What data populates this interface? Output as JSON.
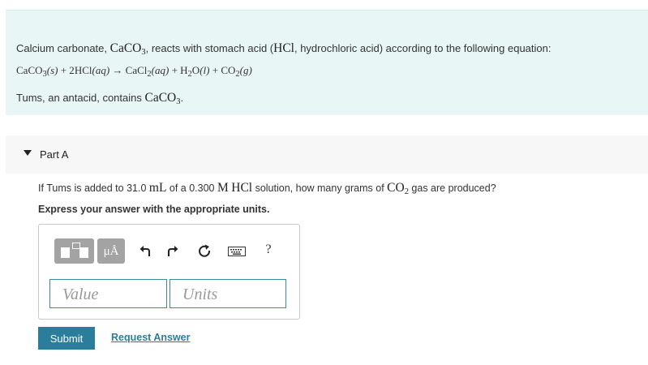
{
  "intro": {
    "line1": {
      "prefix": "Calcium carbonate, ",
      "formula_main": "CaCO",
      "formula_sub": "3",
      "middle": ", reacts with stomach acid (",
      "hcl": "HCl",
      "suffix": ", hydrochloric acid) according to the following equation:"
    },
    "equation": {
      "r1": "CaCO",
      "r1_sub": "3",
      "r1_state": "(s)",
      "plus1": " + 2",
      "r2": "HCl",
      "r2_state": "(aq)",
      "arrow": " → ",
      "p1": "CaCl",
      "p1_sub": "2",
      "p1_state": "(aq)",
      "plus2": " + ",
      "p2a": "H",
      "p2_sub": "2",
      "p2b": "O",
      "p2_state": "(l)",
      "plus3": " + ",
      "p3": "CO",
      "p3_sub": "2",
      "p3_state": "(g)"
    },
    "line3": {
      "prefix": "Tums, an antacid, contains ",
      "formula_main": "CaCO",
      "formula_sub": "3",
      "suffix": "."
    }
  },
  "part": {
    "title": "Part A"
  },
  "question": {
    "prefix": "If Tums is added to 31.0 ",
    "unit": "mL",
    "middle": " of a 0.300 ",
    "molar": "M",
    "space": " ",
    "hcl": "HCl",
    "middle2": " solution, how many grams of ",
    "co2": "CO",
    "co2_sub": "2",
    "suffix": " gas are produced?"
  },
  "instruction": "Express your answer with the appropriate units.",
  "toolbar": {
    "units_label": "μÅ",
    "help_label": "?"
  },
  "inputs": {
    "value_placeholder": "Value",
    "units_placeholder": "Units"
  },
  "actions": {
    "submit": "Submit",
    "request_answer": "Request Answer"
  },
  "colors": {
    "intro_bg": "#e8f6f5",
    "accent": "#2a7e9b",
    "toolbar_button": "#a3a3a3"
  }
}
